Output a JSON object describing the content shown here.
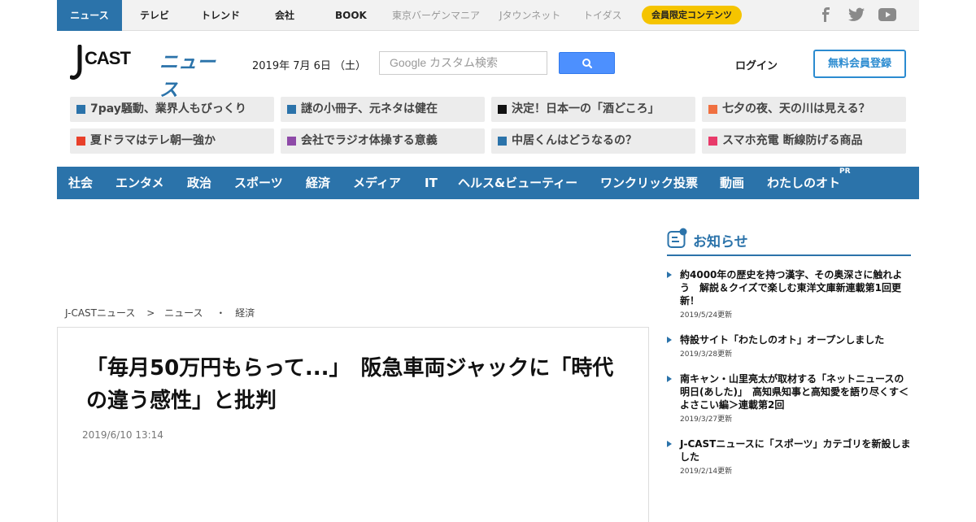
{
  "topbar": {
    "tabs": [
      {
        "label": "ニュース",
        "active": true
      },
      {
        "label": "テレビ"
      },
      {
        "label": "トレンド"
      },
      {
        "label": "会社"
      },
      {
        "label": "BOOK"
      },
      {
        "label": "東京バーゲンマニア",
        "sub": true
      },
      {
        "label": "Jタウンネット",
        "sub": true
      },
      {
        "label": "トイダス",
        "sub": true
      }
    ],
    "members_pill": "会員限定コンテンツ",
    "social_icons": [
      "facebook-icon",
      "twitter-icon",
      "youtube-icon"
    ]
  },
  "header": {
    "logo_text_1": "CAST",
    "logo_text_2": "ニュース",
    "date": "2019年 7月 6日 （土）",
    "search_placeholder": "Google カスタム検索",
    "login": "ログイン",
    "register": "無料会員登録"
  },
  "topics": [
    {
      "label": "7pay騒動、業界人もびっくり",
      "color": "#2b73aa"
    },
    {
      "label": "謎の小冊子、元ネタは健在",
      "color": "#2b73aa"
    },
    {
      "label": "決定！日本一の「酒どころ」",
      "color": "#111111"
    },
    {
      "label": "七夕の夜、天の川は見える？",
      "color": "#f07040"
    },
    {
      "label": "夏ドラマはテレ朝一強か",
      "color": "#e8402a"
    },
    {
      "label": "会社でラジオ体操する意義",
      "color": "#8e4aa8"
    },
    {
      "label": "中居くんはどうなるの？",
      "color": "#2b73aa"
    },
    {
      "label": "スマホ充電 断線防げる商品",
      "color": "#e83a6a"
    }
  ],
  "categories": [
    "社会",
    "エンタメ",
    "政治",
    "スポーツ",
    "経済",
    "メディア",
    "IT",
    "ヘルス&ビューティー",
    "ワンクリック投票",
    "動画",
    "わたしのオト"
  ],
  "pr_badge": "PR",
  "breadcrumb": {
    "home": "J-CASTニュース",
    "sep1": ">",
    "section": "ニュース",
    "sep2": "・",
    "category": "経済"
  },
  "article": {
    "headline": "「毎月50万円もらって...」　阪急車両ジャックに「時代の違う感性」と批判",
    "posted": "2019/6/10 13:14"
  },
  "sidebar": {
    "title": "お知らせ",
    "items": [
      {
        "title": "約4000年の歴史を持つ漢字、その奥深さに触れよう　解説＆クイズで楽しむ東洋文庫新連載第1回更新！",
        "date": "2019/5/24更新"
      },
      {
        "title": "特設サイト「わたしのオト」オープンしました",
        "date": "2019/3/28更新"
      },
      {
        "title": "南キャン・山里亮太が取材する「ネットニュースの明日(あした)」　高知県知事と高知愛を語り尽くす＜よさこい編＞連載第2回",
        "date": "2019/3/27更新"
      },
      {
        "title": "J-CASTニュースに「スポーツ」カテゴリを新設しました",
        "date": "2019/2/14更新"
      }
    ]
  }
}
